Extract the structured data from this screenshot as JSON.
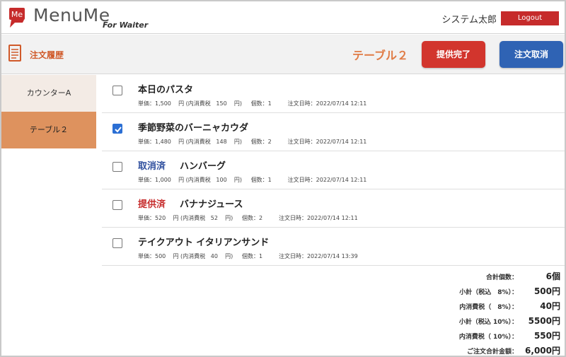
{
  "header": {
    "app_name": "MenuMe",
    "app_sub": "For Waiter",
    "logo_mark": "Me",
    "user_name": "システム太郎",
    "logout_label": "Logout"
  },
  "subbar": {
    "history_label": "注文履歴",
    "table_title": "テーブル２",
    "served_button": "提供完了",
    "cancel_button": "注文取消"
  },
  "sidebar": {
    "items": [
      {
        "label": "カウンターA",
        "selected": false
      },
      {
        "label": "テーブル２",
        "selected": true
      }
    ]
  },
  "orders": [
    {
      "name": "本日のパスタ",
      "status": "",
      "checked": false,
      "price_label": "単価：1,500",
      "yen": "円",
      "tax_label": "(内消費税",
      "tax": "150",
      "tax_yen": "円)",
      "qty_label": "個数：1",
      "time_label": "注文日時：2022/07/14 12:11"
    },
    {
      "name": "季節野菜のバーニャカウダ",
      "status": "",
      "checked": true,
      "price_label": "単価：1,480",
      "yen": "円",
      "tax_label": "(内消費税",
      "tax": "148",
      "tax_yen": "円)",
      "qty_label": "個数：2",
      "time_label": "注文日時：2022/07/14 12:11"
    },
    {
      "name": "ハンバーグ",
      "status": "取消済",
      "checked": false,
      "price_label": "単価：1,000",
      "yen": "円",
      "tax_label": "(内消費税",
      "tax": "100",
      "tax_yen": "円)",
      "qty_label": "個数：1",
      "time_label": "注文日時：2022/07/14 12:11"
    },
    {
      "name": "バナナジュース",
      "status": "提供済",
      "checked": false,
      "price_label": "単価：520",
      "yen": "円",
      "tax_label": "(内消費税",
      "tax": "52",
      "tax_yen": "円)",
      "qty_label": "個数：2",
      "time_label": "注文日時：2022/07/14 12:11"
    },
    {
      "name": "テイクアウト イタリアンサンド",
      "status": "",
      "checked": false,
      "price_label": "単価：500",
      "yen": "円",
      "tax_label": "(内消費税",
      "tax": "40",
      "tax_yen": "円)",
      "qty_label": "個数：1",
      "time_label": "注文日時：2022/07/14 13:39"
    }
  ],
  "totals": [
    {
      "label": "合計個数：",
      "value": "6個"
    },
    {
      "label": "小計（税込　8%）：",
      "value": "500円"
    },
    {
      "label": "内消費税（　8%）：",
      "value": "40円"
    },
    {
      "label": "小計（税込 10%）：",
      "value": "5500円"
    },
    {
      "label": "内消費税（ 10%）：",
      "value": "550円"
    },
    {
      "label": "ご注文合計金額：",
      "value": "6,000円"
    }
  ],
  "colors": {
    "brand_red": "#c62b2b",
    "accent_orange": "#e07b45",
    "cancel_blue": "#2f63b4",
    "selected_table": "#de925e"
  }
}
